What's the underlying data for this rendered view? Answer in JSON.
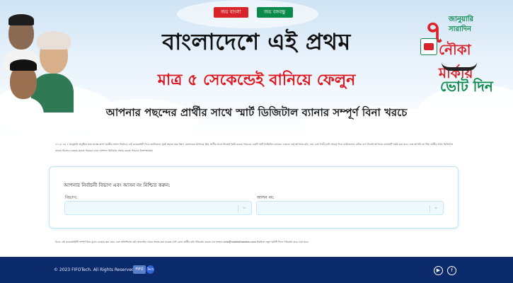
{
  "banner": {
    "tag_left": "জয় বাংলা",
    "tag_right": "জয় বঙ্গবন্ধু",
    "headline_1": "বাংলাদেশে এই প্রথম",
    "headline_2": "মাত্র ৫ সেকেন্ডেই বানিয়ে ফেলুন",
    "headline_3": "আপনার পছন্দের প্রার্থীর সাথে স্মার্ট ডিজিটাল ব্যানার সম্পূর্ণ বিনা খরচে",
    "badge": {
      "number": "৭",
      "line_1": "জানুয়ারি",
      "line_2": "সারাদিন",
      "line_3": "নৌকা মার্কায়",
      "line_4": "ভোট দিন"
    }
  },
  "intro_text": "২০২৪ এর ৭ জানুয়ারি অনুষ্ঠিত হতে যাচ্ছে দ্বাদশ জাতীয় সংসদ নির্বাচন। এই ওয়েবসাইট দিয়ে ভোটারদের খুবই সহজে তার পছন্দ মোতাবেক আপনার প্রিয় প্রার্থীর সাথে নিজেই তৈরি করতে পারবেন একটি স্মার্ট ডিজিটাল ব্যানার। এজন্যে শুধু আপনার ছবি, নাম এবং পদবী (যদি থাকে) দিয়ে ডাউনলোড বাটনে চাপ দিলেই আপনার ব্যানারটি তৈরি হয়ে যাবে এবং আপনি তা প্রিয় প্রার্থীর সাথে ডিজিটাল ব্যানার হিসেবে ব্যবহার করতে পারবেন এবং সোশ্যাল মিডিয়ায় শেয়ার করতে পারবেন ইনশাআল্লাহ।",
  "form": {
    "title": "আপনার নির্বাচনী বিভাগ এবং আসন নং নিশ্চিত করুন:",
    "division_label": "বিভাগ:",
    "division_value": "",
    "seat_label": "আসন নং:",
    "seat_value": ""
  },
  "note_text": "বি:দ্র: এই ওয়েবসাইটটি সম্পূর্ণ বিনা মূল্যে ব্যবহার করা যাবে এবং অফিশিয়াল ছবি অনলাইন থেকে সংগ্রহ করা হয়েছে। যদি কোন প্রার্থীর ছবি পরিবর্তন করতে চান তাহলে info@nowhidhossain.com ইমেইলে নতুন ছবিটি দিলে পরিবর্তন করে দেয়া হবে।",
  "footer": {
    "copyright": "© 2023 FIFOTech. All Rights Reserved",
    "logo_text": "FIFO",
    "logo_badge": "Tech"
  },
  "colors": {
    "brand_red": "#d8232a",
    "brand_green": "#0a8a4a",
    "footer_bg": "#0b2a6b",
    "field_bg": "#eef9fd"
  },
  "icons": {
    "chevron": "chevron-down-icon",
    "youtube": "youtube-icon",
    "facebook": "facebook-icon"
  }
}
